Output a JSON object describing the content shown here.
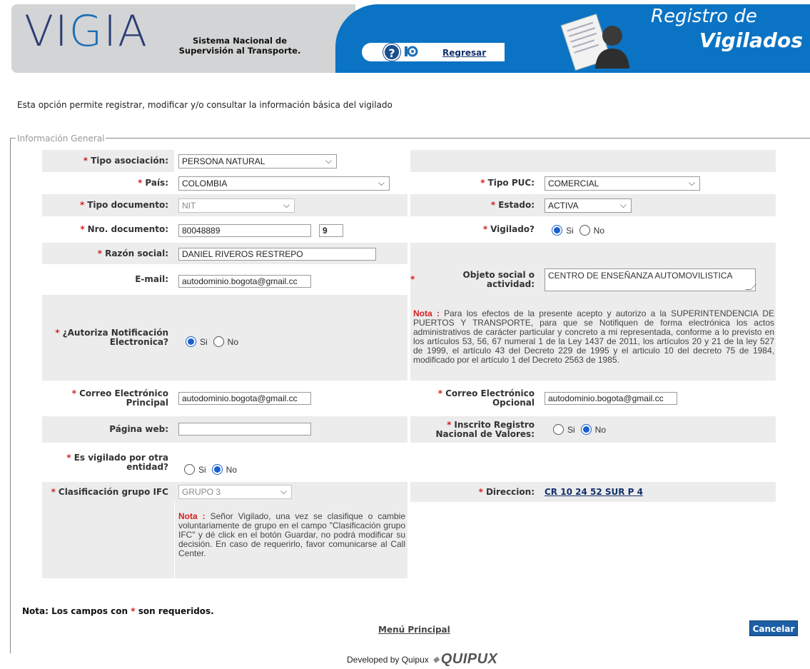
{
  "header": {
    "logo_left": "VI",
    "logo_g": "G",
    "logo_right": "IA",
    "logo_subtitle": "Sistema Nacional de Supervisión al Transporte.",
    "help_symbol": "?",
    "back_link": "Regresar",
    "title_line1": "Registro de",
    "title_line2": "Vigilados",
    "icons": [
      "help-icon",
      "vigia-mini-icon",
      "document-person-icon"
    ]
  },
  "intro_text": "Esta opción permite registrar, modificar y/o consultar la información básica del vigilado",
  "fieldset_legend": "Información General",
  "form": {
    "tipo_asociacion": {
      "label": "Tipo asociación:",
      "value": "PERSONA NATURAL"
    },
    "pais": {
      "label": "País:",
      "value": "COLOMBIA"
    },
    "tipo_puc": {
      "label": "Tipo PUC:",
      "value": "COMERCIAL"
    },
    "tipo_documento": {
      "label": "Tipo documento:",
      "value": "NIT"
    },
    "estado": {
      "label": "Estado:",
      "value": "ACTIVA"
    },
    "nro_documento": {
      "label": "Nro. documento:",
      "value": "80048889",
      "dv": "9"
    },
    "vigilado": {
      "label": "Vigilado?",
      "opt_si": "Si",
      "opt_no": "No",
      "selected": "Si"
    },
    "razon_social": {
      "label": "Razón social:",
      "value": "DANIEL RIVEROS RESTREPO"
    },
    "email": {
      "label": "E-mail:",
      "value": "autodominio.bogota@gmail.cc"
    },
    "objeto_social": {
      "label": "Objeto social o actividad:",
      "value": "CENTRO DE ENSEÑANZA AUTOMOVILISTICA"
    },
    "autoriza": {
      "label": "¿Autoriza Notificación Electronica?",
      "opt_si": "Si",
      "opt_no": "No",
      "selected": "Si"
    },
    "nota_autoriza": {
      "key": "Nota :",
      "text": "Para los efectos de la presente acepto y autorizo a la SUPERINTENDENCIA DE PUERTOS Y TRANSPORTE, para que se Notifiquen de forma electrónica los actos administrativos de carácter particular y concreto a mi representada, conforme a lo previsto en los artículos 53, 56, 67 numeral 1 de la Ley 1437 de 2011, los artículos 20 y 21 de la ley 527 de 1999, el artículo 43 del Decreto 229 de 1995 y el articulo 10 del decreto 75 de 1984, modificado por el artículo 1 del Decreto 2563 de 1985."
    },
    "correo_principal": {
      "label": "Correo Electrónico Principal",
      "value": "autodominio.bogota@gmail.cc"
    },
    "correo_opcional": {
      "label": "Correo Electrónico Opcional",
      "value": "autodominio.bogota@gmail.cc"
    },
    "pagina_web": {
      "label": "Página web:",
      "value": ""
    },
    "inscrito_rnv": {
      "label": "Inscrito Registro Nacional de Valores:",
      "opt_si": "Si",
      "opt_no": "No",
      "selected": "No"
    },
    "vigilado_otra": {
      "label": "Es vigilado por otra entidad?",
      "opt_si": "Si",
      "opt_no": "No",
      "selected": "No"
    },
    "clasificacion_ifc": {
      "label": "Clasificación grupo IFC",
      "value": "GRUPO 3"
    },
    "direccion": {
      "label": "Direccion:",
      "value": "CR 10 24 52 SUR P 4"
    },
    "nota_ifc": {
      "key": "Nota :",
      "text": "Señor Vigilado, una vez se clasifique o cambie voluntariamente de grupo en el campo \"Clasificación grupo IFC\" y dé click en el botón Guardar, no podrá modificar su decisión. En caso de requerirlo, favor comunicarse al Call Center."
    }
  },
  "footer": {
    "required_note_prefix": "Nota: Los campos con",
    "required_star": "*",
    "required_note_suffix": "son requeridos.",
    "menu_link": "Menú Principal",
    "cancel_button": "Cancelar",
    "developed_by": "Developed by Quipux",
    "quipux_logo": "QUIPUX"
  },
  "colors": {
    "header_blue": "#0b73c4",
    "header_gray": "#d3d4d5",
    "required_red": "#d42020",
    "row_alt": "#ececec",
    "cancel_blue": "#1d5fa6"
  }
}
